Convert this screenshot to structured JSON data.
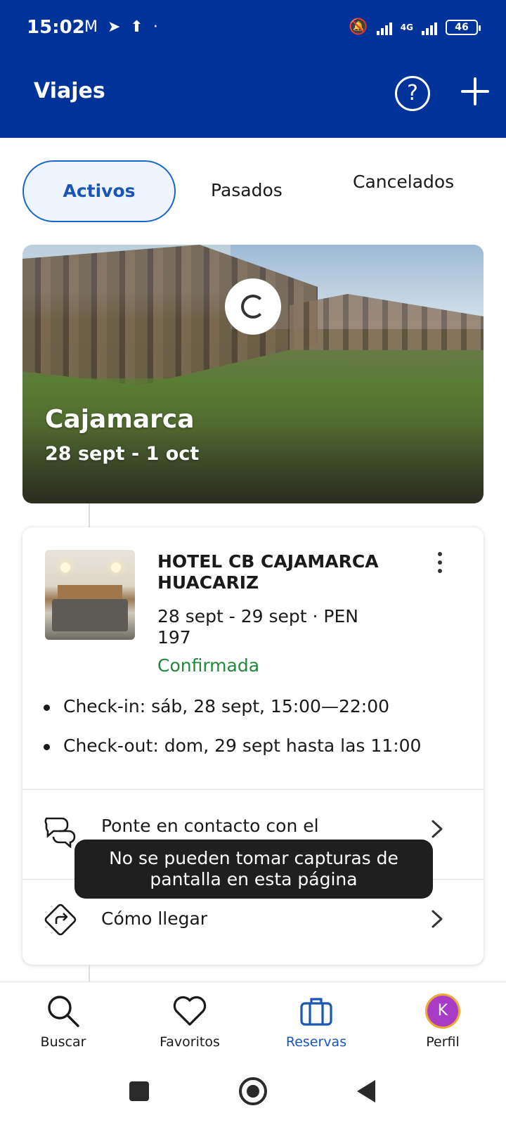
{
  "status_bar": {
    "time": "15:02",
    "battery": "46",
    "network": "4G"
  },
  "header": {
    "title": "Viajes",
    "help_glyph": "?"
  },
  "tabs": [
    {
      "label": "Activos",
      "selected": true
    },
    {
      "label": "Pasados",
      "selected": false
    },
    {
      "label": "Cancelados",
      "selected": false
    }
  ],
  "trip": {
    "city": "Cajamarca",
    "dates": "28 sept - 1 oct"
  },
  "booking": {
    "hotel_name": "HOTEL CB CAJAMARCA HUACARIZ",
    "dates_price": "28 sept - 29 sept · PEN 197",
    "status": "Confirmada",
    "status_color": "#1e8a3a",
    "checkin": "Check-in: sáb, 28 sept, 15:00—22:00",
    "checkout": "Check-out: dom, 29 sept hasta las 11:00",
    "contact_label": "Ponte en contacto con el",
    "directions_label": "Cómo llegar"
  },
  "toast": {
    "message": "No se pueden tomar capturas de pantalla en esta página"
  },
  "bottom_nav": [
    {
      "label": "Buscar",
      "icon": "search-icon"
    },
    {
      "label": "Favoritos",
      "icon": "heart-icon"
    },
    {
      "label": "Reservas",
      "icon": "suitcase-icon",
      "active": true
    },
    {
      "label": "Perfil",
      "icon": "avatar",
      "initial": "K"
    }
  ],
  "colors": {
    "brand": "#003399",
    "accent": "#1a55b8"
  }
}
